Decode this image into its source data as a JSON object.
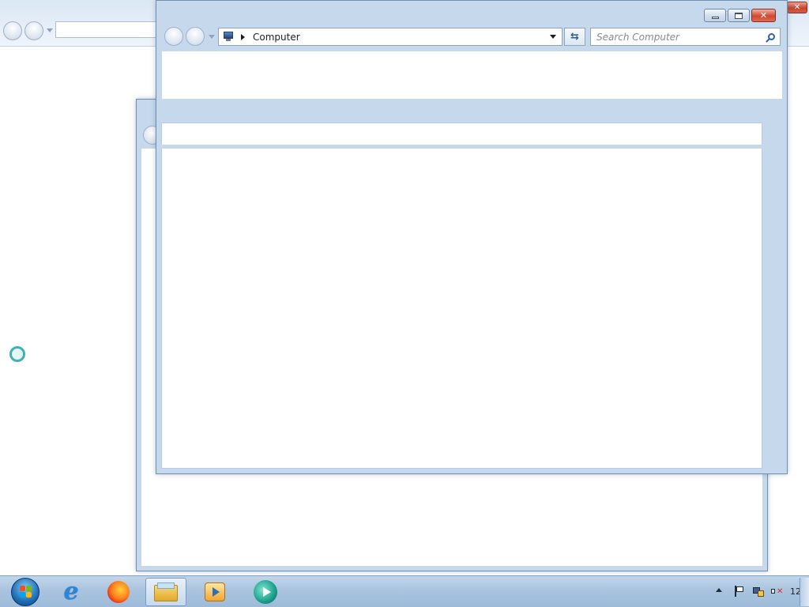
{
  "explorer_front": {
    "breadcrumb": "Computer",
    "search_placeholder": "Search Computer"
  },
  "taskbar": {
    "items": [
      "start",
      "internet-explorer",
      "firefox",
      "windows-explorer",
      "media-player",
      "app"
    ],
    "clock_partial": "12"
  },
  "colors": {
    "accent": "#6d8fb3",
    "close": "#c7432c",
    "taskbar": "#aac4df"
  }
}
